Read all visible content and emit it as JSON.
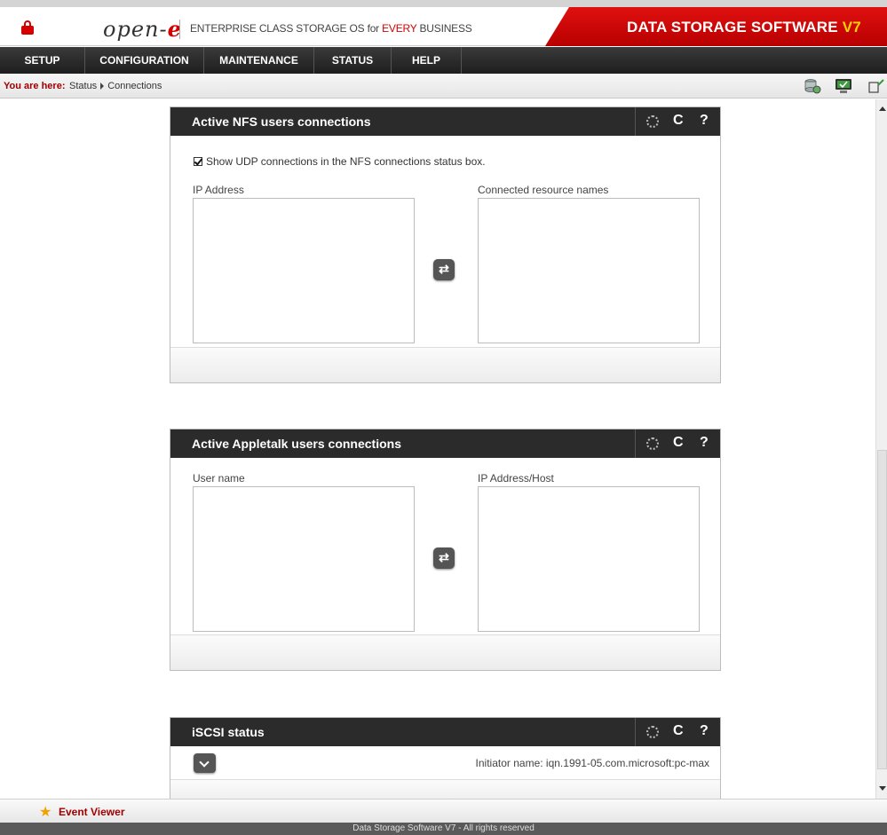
{
  "header": {
    "logo_prefix": "open-",
    "logo_e": "e",
    "tagline_part1": "ENTERPRISE CLASS STORAGE OS for ",
    "tagline_red": "EVERY",
    "tagline_part2": " BUSINESS",
    "brand_main": "DATA STORAGE SOFTWARE ",
    "brand_version": "V7"
  },
  "nav": {
    "items": [
      {
        "label": "SETUP"
      },
      {
        "label": "CONFIGURATION"
      },
      {
        "label": "MAINTENANCE"
      },
      {
        "label": "STATUS"
      },
      {
        "label": "HELP"
      }
    ]
  },
  "breadcrumb": {
    "label": "You are here:",
    "path1": "Status",
    "path2": "Connections"
  },
  "nfs_panel": {
    "title": "Active NFS users connections",
    "checkbox_label": "Show UDP connections in the NFS connections status box.",
    "checkbox_checked": true,
    "left_label": "IP Address",
    "right_label": "Connected resource names"
  },
  "appletalk_panel": {
    "title": "Active Appletalk users connections",
    "left_label": "User name",
    "right_label": "IP Address/Host"
  },
  "iscsi_panel": {
    "title": "iSCSI status",
    "initiator": "Initiator name: iqn.1991-05.com.microsoft:pc-max"
  },
  "tools": {
    "refresh": "C",
    "help": "?",
    "swap": "⇄"
  },
  "footer": {
    "event_viewer": "Event Viewer",
    "star": "★",
    "copyright": "Data Storage Software V7 - All rights reserved"
  },
  "colors": {
    "accent_red": "#d40000",
    "dark_bar": "#2b2b2b",
    "version_yellow": "#ffd200"
  }
}
